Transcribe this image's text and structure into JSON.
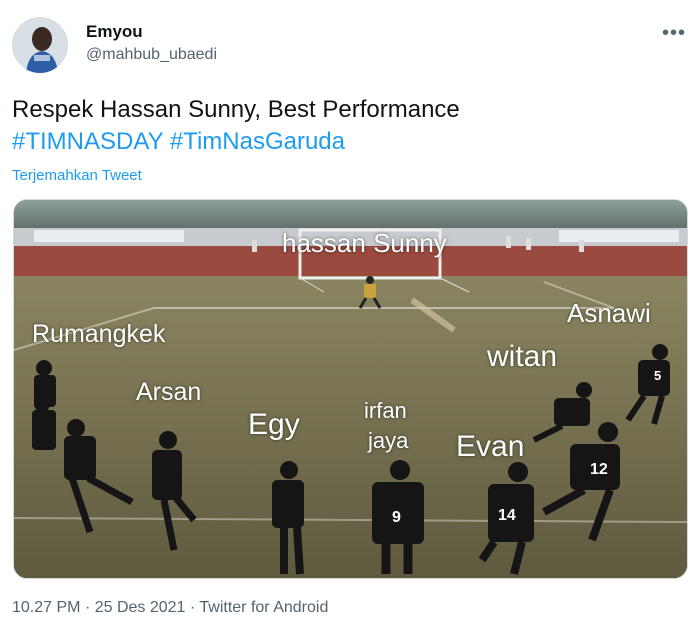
{
  "user": {
    "display_name": "Emyou",
    "handle": "@mahbub_ubaedi",
    "avatar_icon": "user-avatar"
  },
  "header": {
    "more_icon": "more-horizontal-icon"
  },
  "tweet": {
    "text_line1": "Respek Hassan Sunny, Best Performance",
    "hashtag1": "#TIMNASDAY",
    "hashtag2": "#TimNasGaruda",
    "translate_label": "Terjemahkan Tweet"
  },
  "media": {
    "labels": {
      "goalkeeper": "hassan Sunny",
      "rumangkek": "Rumangkek",
      "arsan": "Arsan",
      "egy": "Egy",
      "irfan_line1": "irfan",
      "irfan_line2": "jaya",
      "evan": "Evan",
      "witan": "witan",
      "asnawi": "Asnawi"
    },
    "jersey_numbers": [
      "9",
      "14",
      "12",
      "5"
    ]
  },
  "meta": {
    "time": "10.27 PM",
    "date": "25 Des 2021",
    "source": "Twitter for Android",
    "separator": "·"
  },
  "colors": {
    "link": "#1d9bf0",
    "secondary": "#536471",
    "text": "#0f1419"
  }
}
